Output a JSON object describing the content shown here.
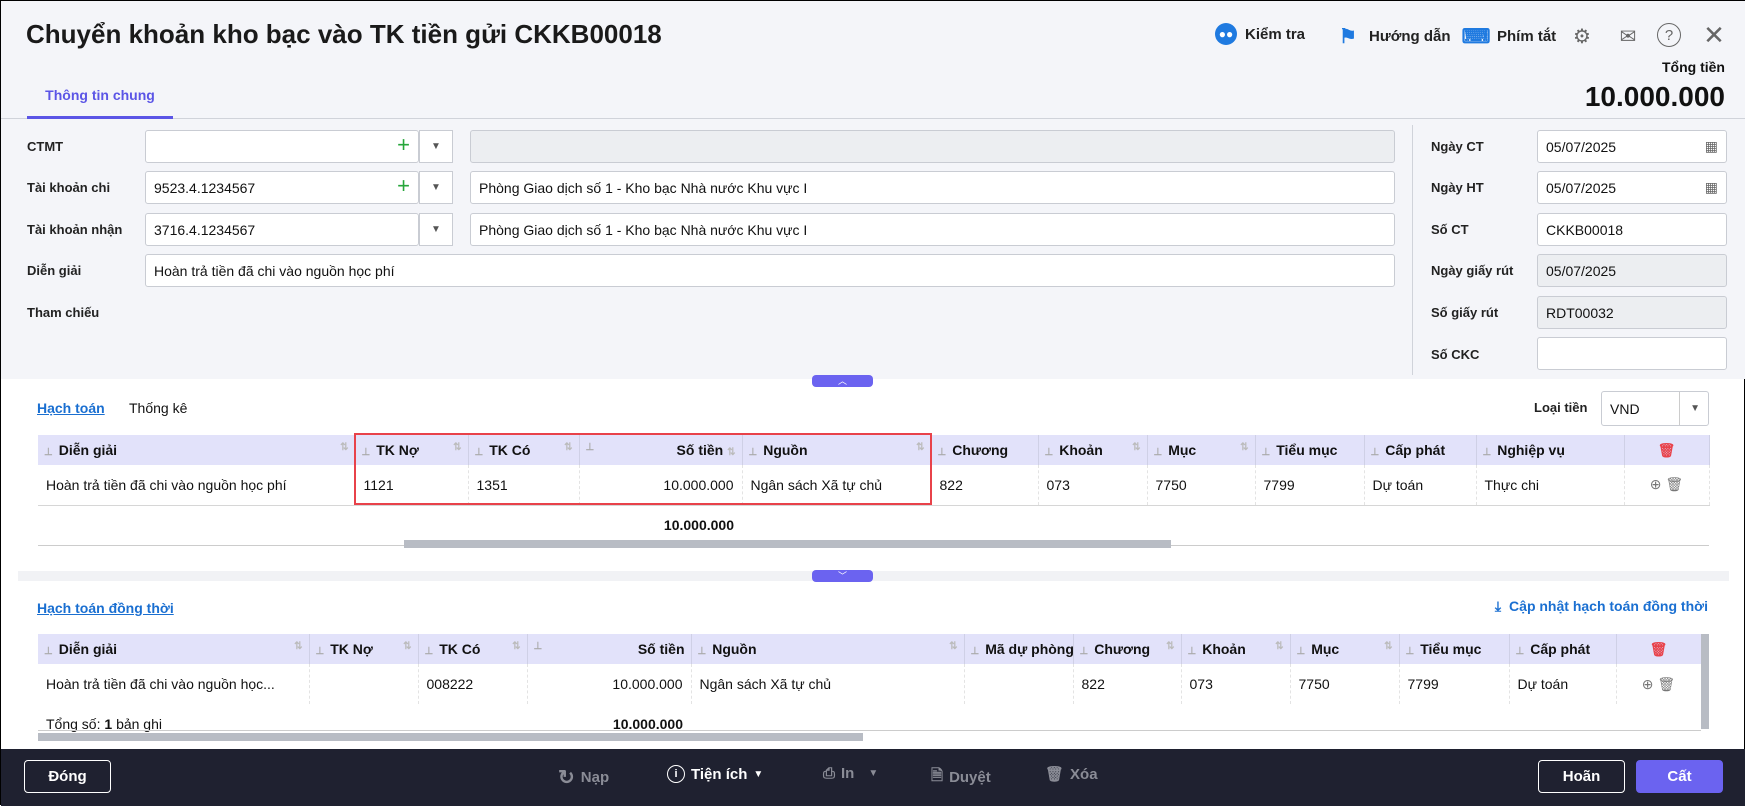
{
  "header": {
    "title": "Chuyển khoản kho bạc vào TK tiền gửi CKKB00018",
    "check": "Kiểm tra",
    "guide": "Hướng dẫn",
    "shortcuts": "Phím tắt",
    "total_label": "Tổng tiền",
    "total_value": "10.000.000"
  },
  "tabs": {
    "general": "Thông tin chung"
  },
  "form": {
    "ctmt": {
      "label": "CTMT",
      "value": "",
      "name": ""
    },
    "tk_chi": {
      "label": "Tài khoản chi",
      "value": "9523.4.1234567",
      "name": "Phòng Giao dịch số 1 - Kho bạc Nhà nước Khu vực I"
    },
    "tk_nhan": {
      "label": "Tài khoản nhận",
      "value": "3716.4.1234567",
      "name": "Phòng Giao dịch số 1 - Kho bạc Nhà nước Khu vực I"
    },
    "dien_giai": {
      "label": "Diễn giải",
      "value": "Hoàn trả tiền đã chi vào nguồn học phí"
    },
    "tham_chieu": {
      "label": "Tham chiếu"
    },
    "ngay_ct": {
      "label": "Ngày CT",
      "value": "05/07/2025"
    },
    "ngay_ht": {
      "label": "Ngày HT",
      "value": "05/07/2025"
    },
    "so_ct": {
      "label": "Số CT",
      "value": "CKKB00018"
    },
    "ngay_giay_rut": {
      "label": "Ngày giấy rút",
      "value": "05/07/2025"
    },
    "so_giay_rut": {
      "label": "Số giấy rút",
      "value": "RDT00032"
    },
    "so_ckc": {
      "label": "Số CKC",
      "value": ""
    }
  },
  "detail": {
    "tab_accounting": "Hạch toán",
    "tab_stats": "Thống kê",
    "currency_label": "Loại tiền",
    "currency": "VND",
    "columns": [
      "Diễn giải",
      "TK Nợ",
      "TK Có",
      "Số tiền",
      "Nguồn",
      "Chương",
      "Khoản",
      "Mục",
      "Tiểu mục",
      "Cấp phát",
      "Nghiệp vụ"
    ],
    "rows": [
      [
        "Hoàn trả tiền đã chi vào nguồn học phí",
        "1121",
        "1351",
        "10.000.000",
        "Ngân sách Xã tự chủ",
        "822",
        "073",
        "7750",
        "7799",
        "Dự toán",
        "Thực chi"
      ]
    ],
    "total": "10.000.000"
  },
  "concurrent": {
    "title": "Hạch toán đồng thời",
    "update": "Cập nhật hạch toán đồng thời",
    "columns": [
      "Diễn giải",
      "TK Nợ",
      "TK Có",
      "Số tiền",
      "Nguồn",
      "Mã dự phòng",
      "Chương",
      "Khoản",
      "Mục",
      "Tiểu mục",
      "Cấp phát"
    ],
    "rows": [
      [
        "Hoàn trả tiền đã chi vào nguồn học...",
        "",
        "008222",
        "10.000.000",
        "Ngân sách Xã tự chủ",
        "",
        "822",
        "073",
        "7750",
        "7799",
        "Dự toán"
      ]
    ],
    "count_prefix": "Tổng số:",
    "count": "1",
    "count_suffix": "bản ghi",
    "total": "10.000.000"
  },
  "footer": {
    "close": "Đóng",
    "reload": "Nạp",
    "utilities": "Tiện ích",
    "print": "In",
    "approve": "Duyệt",
    "delete": "Xóa",
    "cancel": "Hoãn",
    "save": "Cất"
  },
  "colors": {
    "accent": "#6b63f0",
    "highlight": "#e8424a",
    "footer": "#1f2130"
  }
}
